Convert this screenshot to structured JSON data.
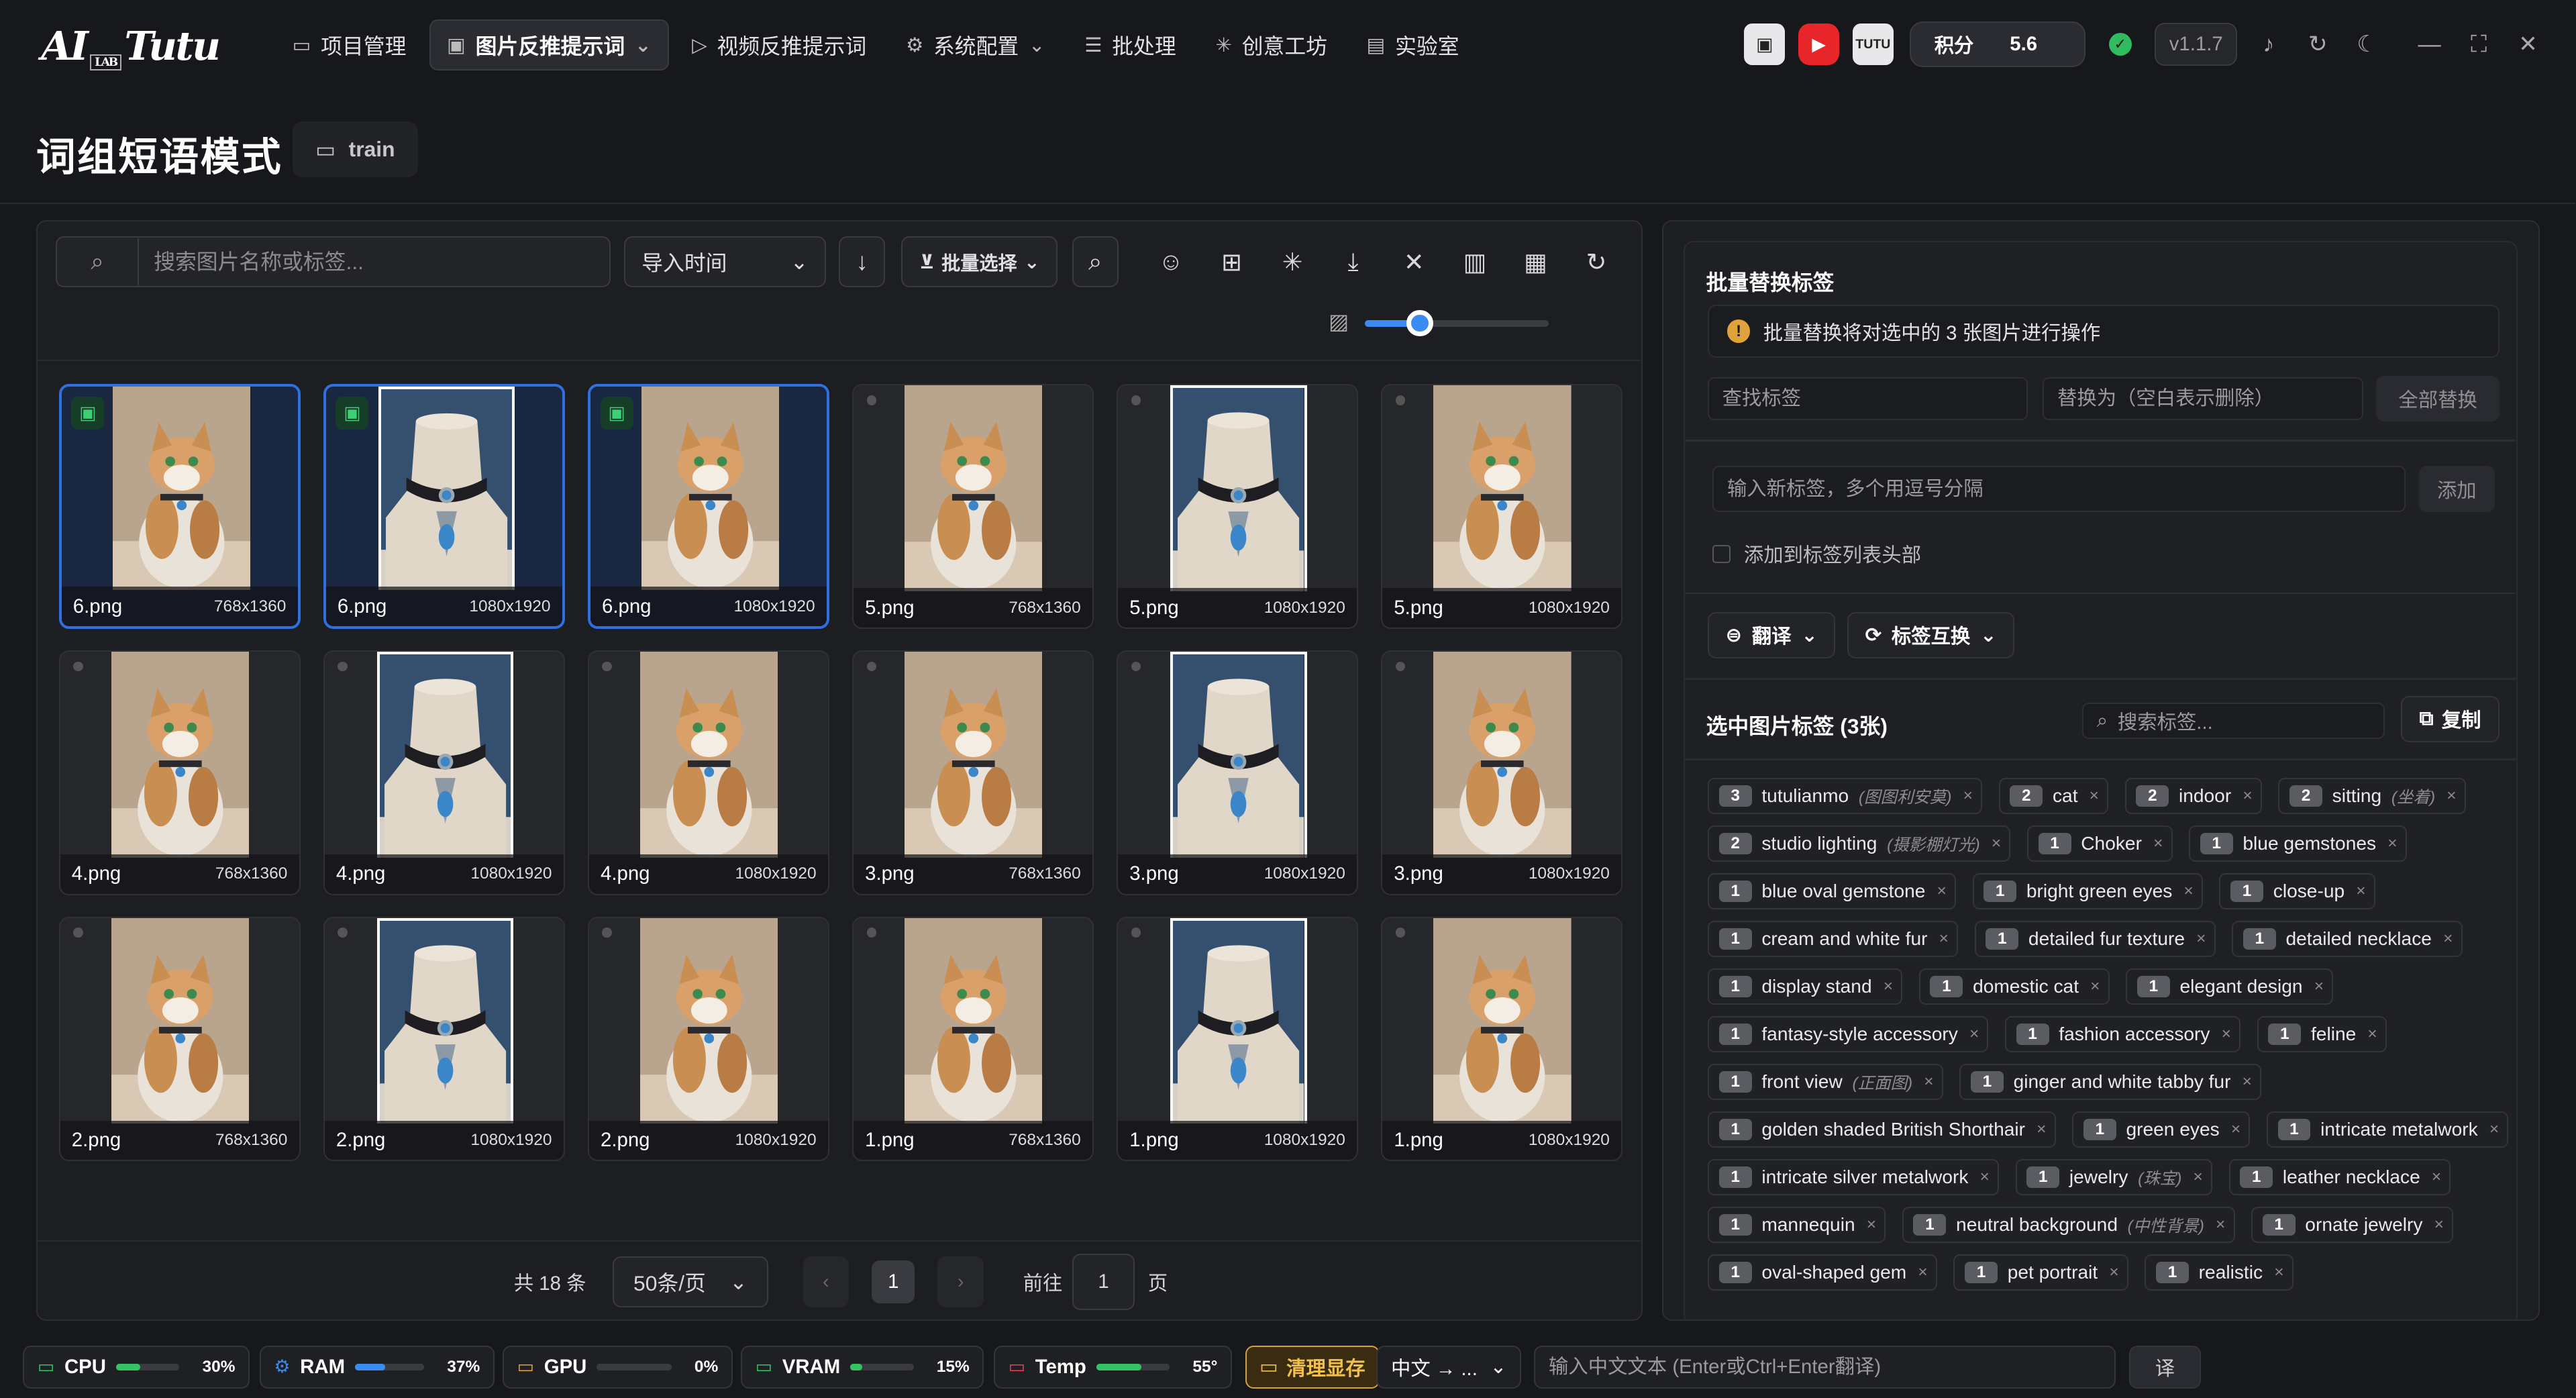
{
  "app": {
    "logo_main": "AI",
    "logo_sub": "LAB",
    "logo_script": "Tutu"
  },
  "nav": [
    {
      "label": "项目管理",
      "icon": "folder-icon",
      "glyph": "▭",
      "active": false
    },
    {
      "label": "图片反推提示词",
      "icon": "image-icon",
      "glyph": "▣",
      "active": true,
      "caret": "⌄"
    },
    {
      "label": "视频反推提示词",
      "icon": "play-circle-icon",
      "glyph": "▷",
      "active": false
    },
    {
      "label": "系统配置",
      "icon": "gear-icon",
      "glyph": "⚙",
      "active": false,
      "caret": "⌄"
    },
    {
      "label": "批处理",
      "icon": "list-icon",
      "glyph": "☰",
      "active": false
    },
    {
      "label": "创意工坊",
      "icon": "sparkle-icon",
      "glyph": "✳",
      "active": false
    },
    {
      "label": "实验室",
      "icon": "flask-icon",
      "glyph": "▤",
      "active": false
    }
  ],
  "topright": {
    "tv_glyph": "▣",
    "youtube_glyph": "▶",
    "tutu_badge": "TUTU",
    "points_label": "积分",
    "points_value": "5.6",
    "ok_glyph": "✓",
    "version": "v1.1.7",
    "bell_glyph": "♪",
    "refresh_glyph": "↻",
    "moon_glyph": "☾",
    "min_glyph": "—",
    "max_glyph": "⛶",
    "close_glyph": "✕",
    "colors": {
      "youtube": "#e8262a",
      "ok": "#2fbb5e",
      "accent": "#3b8bf2"
    }
  },
  "header": {
    "title": "词组短语模式",
    "folder_glyph": "▭",
    "folder": "train"
  },
  "toolbar": {
    "search_placeholder": "搜索图片名称或标签...",
    "search_glyph": "⌕",
    "sort_label": "导入时间",
    "caret": "⌄",
    "sort_dir_glyph": "↓",
    "batch_glyph": "⊻",
    "batch_label": "批量选择",
    "icons": [
      {
        "name": "find-icon",
        "glyph": "⌕"
      },
      {
        "name": "tag-ai-icon",
        "glyph": "☺"
      },
      {
        "name": "add-folder-icon",
        "glyph": "⊞"
      },
      {
        "name": "magic-icon",
        "glyph": "✳"
      },
      {
        "name": "download-icon",
        "glyph": "⤓"
      },
      {
        "name": "clear-icon",
        "glyph": "✕"
      },
      {
        "name": "trash-icon",
        "glyph": "▥"
      },
      {
        "name": "grid-view-icon",
        "glyph": "▦"
      },
      {
        "name": "reset-icon",
        "glyph": "↻"
      }
    ],
    "size_glyph": "▨",
    "thumb_size": 0.3
  },
  "images": [
    {
      "name": "6.png",
      "dim": "768x1360",
      "kind": "cat",
      "selected": true
    },
    {
      "name": "6.png",
      "dim": "1080x1920",
      "kind": "neck",
      "selected": true
    },
    {
      "name": "6.png",
      "dim": "1080x1920",
      "kind": "cat",
      "selected": true
    },
    {
      "name": "5.png",
      "dim": "768x1360",
      "kind": "cat",
      "selected": false
    },
    {
      "name": "5.png",
      "dim": "1080x1920",
      "kind": "neck",
      "selected": false
    },
    {
      "name": "5.png",
      "dim": "1080x1920",
      "kind": "cat",
      "selected": false
    },
    {
      "name": "4.png",
      "dim": "768x1360",
      "kind": "cat",
      "selected": false
    },
    {
      "name": "4.png",
      "dim": "1080x1920",
      "kind": "neck",
      "selected": false
    },
    {
      "name": "4.png",
      "dim": "1080x1920",
      "kind": "cat",
      "selected": false
    },
    {
      "name": "3.png",
      "dim": "768x1360",
      "kind": "cat",
      "selected": false
    },
    {
      "name": "3.png",
      "dim": "1080x1920",
      "kind": "neck",
      "selected": false
    },
    {
      "name": "3.png",
      "dim": "1080x1920",
      "kind": "cat",
      "selected": false
    },
    {
      "name": "2.png",
      "dim": "768x1360",
      "kind": "cat",
      "selected": false
    },
    {
      "name": "2.png",
      "dim": "1080x1920",
      "kind": "neck",
      "selected": false
    },
    {
      "name": "2.png",
      "dim": "1080x1920",
      "kind": "cat",
      "selected": false
    },
    {
      "name": "1.png",
      "dim": "768x1360",
      "kind": "cat",
      "selected": false
    },
    {
      "name": "1.png",
      "dim": "1080x1920",
      "kind": "neck",
      "selected": false
    },
    {
      "name": "1.png",
      "dim": "1080x1920",
      "kind": "cat",
      "selected": false
    }
  ],
  "lock_glyph": "▣",
  "pager": {
    "total": "共 18 条",
    "page_size": "50条/页",
    "caret": "⌄",
    "prev": "‹",
    "page": "1",
    "next": "›",
    "goto_label": "前往",
    "goto_value": "1",
    "page_suffix": "页"
  },
  "replace": {
    "title": "批量替换标签",
    "warn_glyph": "!",
    "warning": "批量替换将对选中的 3 张图片进行操作",
    "find_placeholder": "查找标签",
    "replace_placeholder": "替换为（空白表示删除）",
    "replace_all": "全部替换",
    "add_placeholder": "输入新标签，多个用逗号分隔",
    "add_button": "添加",
    "prepend_label": "添加到标签列表头部",
    "translate_glyph": "⊜",
    "translate": "翻译",
    "swap_glyph": "⟳",
    "swap": "标签互换",
    "caret": "⌄"
  },
  "selected_tags": {
    "title": "选中图片标签 (3张)",
    "search_glyph": "⌕",
    "search_placeholder": "搜索标签...",
    "copy_glyph": "⧉",
    "copy": "复制",
    "remove_glyph": "×",
    "tags": [
      {
        "count": "3",
        "text": "tutulianmo",
        "tr": "(图图利安莫)"
      },
      {
        "count": "2",
        "text": "cat",
        "tr": ""
      },
      {
        "count": "2",
        "text": "indoor",
        "tr": ""
      },
      {
        "count": "2",
        "text": "sitting",
        "tr": "(坐着)"
      },
      {
        "count": "2",
        "text": "studio lighting",
        "tr": "(摄影棚灯光)"
      },
      {
        "count": "1",
        "text": "Choker",
        "tr": ""
      },
      {
        "count": "1",
        "text": "blue gemstones",
        "tr": ""
      },
      {
        "count": "1",
        "text": "blue oval gemstone",
        "tr": ""
      },
      {
        "count": "1",
        "text": "bright green eyes",
        "tr": ""
      },
      {
        "count": "1",
        "text": "close-up",
        "tr": ""
      },
      {
        "count": "1",
        "text": "cream and white fur",
        "tr": ""
      },
      {
        "count": "1",
        "text": "detailed fur texture",
        "tr": ""
      },
      {
        "count": "1",
        "text": "detailed necklace",
        "tr": ""
      },
      {
        "count": "1",
        "text": "display stand",
        "tr": ""
      },
      {
        "count": "1",
        "text": "domestic cat",
        "tr": ""
      },
      {
        "count": "1",
        "text": "elegant design",
        "tr": ""
      },
      {
        "count": "1",
        "text": "fantasy-style accessory",
        "tr": ""
      },
      {
        "count": "1",
        "text": "fashion accessory",
        "tr": ""
      },
      {
        "count": "1",
        "text": "feline",
        "tr": ""
      },
      {
        "count": "1",
        "text": "front view",
        "tr": "(正面图)"
      },
      {
        "count": "1",
        "text": "ginger and white tabby fur",
        "tr": ""
      },
      {
        "count": "1",
        "text": "golden shaded British Shorthair",
        "tr": ""
      },
      {
        "count": "1",
        "text": "green eyes",
        "tr": ""
      },
      {
        "count": "1",
        "text": "intricate metalwork",
        "tr": ""
      },
      {
        "count": "1",
        "text": "intricate silver metalwork",
        "tr": ""
      },
      {
        "count": "1",
        "text": "jewelry",
        "tr": "(珠宝)"
      },
      {
        "count": "1",
        "text": "leather necklace",
        "tr": ""
      },
      {
        "count": "1",
        "text": "mannequin",
        "tr": ""
      },
      {
        "count": "1",
        "text": "neutral background",
        "tr": "(中性背景)"
      },
      {
        "count": "1",
        "text": "ornate jewelry",
        "tr": ""
      },
      {
        "count": "1",
        "text": "oval-shaped gem",
        "tr": ""
      },
      {
        "count": "1",
        "text": "pet portrait",
        "tr": ""
      },
      {
        "count": "1",
        "text": "realistic",
        "tr": ""
      }
    ]
  },
  "status": {
    "cpu": {
      "label": "CPU",
      "glyph": "▭",
      "pct": "30%",
      "value": 0.3,
      "color": "#35c463",
      "icon_color": "#35c463"
    },
    "ram": {
      "label": "RAM",
      "glyph": "⚙",
      "pct": "37%",
      "value": 0.37,
      "color": "#3b8bf2",
      "icon_color": "#3b8bf2"
    },
    "gpu": {
      "label": "GPU",
      "glyph": "▭",
      "pct": "0%",
      "value": 0.0,
      "color": "#e0a23b",
      "icon_color": "#e0a23b"
    },
    "vram": {
      "label": "VRAM",
      "glyph": "▭",
      "pct": "15%",
      "value": 0.15,
      "color": "#35c463",
      "icon_color": "#35c463"
    },
    "temp": {
      "label": "Temp",
      "glyph": "▭",
      "pct": "55°",
      "value": 0.55,
      "color": "#35c463",
      "icon_color": "#e8434d"
    },
    "clean_glyph": "▭",
    "clean": "清理显存",
    "lang": "中文 → ...",
    "caret": "⌄",
    "translate_placeholder": "输入中文文本 (Enter或Ctrl+Enter翻译)",
    "translate_btn": "译"
  }
}
